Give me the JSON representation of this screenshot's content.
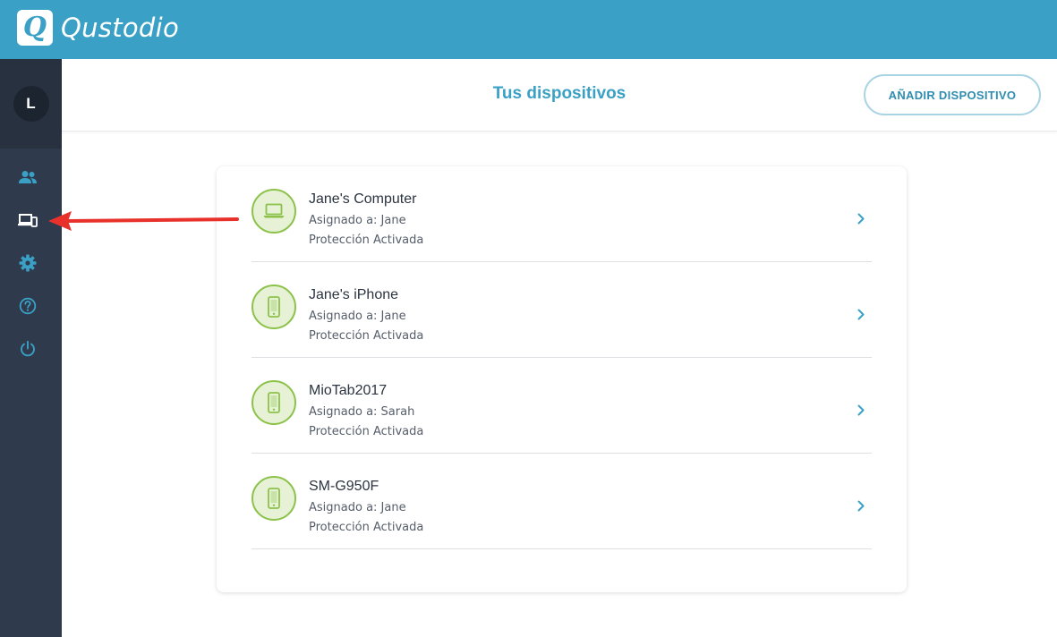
{
  "app": {
    "logo_letter": "Q",
    "name": "Qustodio",
    "brand_color": "#3aa0c5"
  },
  "sidebar": {
    "user_initial": "L",
    "items": [
      {
        "name": "family",
        "icon": "people-icon"
      },
      {
        "name": "devices",
        "icon": "devices-icon",
        "active": true
      },
      {
        "name": "settings",
        "icon": "gear-icon"
      },
      {
        "name": "help",
        "icon": "question-icon"
      },
      {
        "name": "logout",
        "icon": "power-icon"
      }
    ]
  },
  "header": {
    "title": "Tus dispositivos",
    "add_button_label": "AÑADIR DISPOSITIVO"
  },
  "devices": [
    {
      "name": "Jane's Computer",
      "assigned": "Asignado a: Jane",
      "status": "Protección Activada",
      "icon": "laptop-icon"
    },
    {
      "name": "Jane's iPhone",
      "assigned": "Asignado a: Jane",
      "status": "Protección Activada",
      "icon": "phone-icon"
    },
    {
      "name": "MioTab2017",
      "assigned": "Asignado a: Sarah",
      "status": "Protección Activada",
      "icon": "phone-icon"
    },
    {
      "name": "SM-G950F",
      "assigned": "Asignado a: Jane",
      "status": "Protección Activada",
      "icon": "phone-icon"
    }
  ],
  "annotation": {
    "arrow_color": "#e8312a",
    "points_to": "devices-icon"
  }
}
